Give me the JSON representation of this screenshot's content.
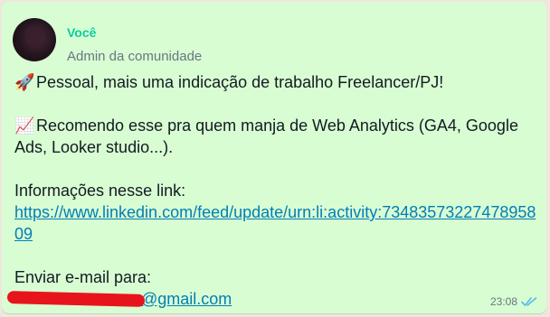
{
  "message": {
    "sender": "Você",
    "role": "Admin da comunidade",
    "line1_emoji": "🚀",
    "line1": "Pessoal, mais uma indicação de trabalho Freelancer/PJ!",
    "line2_emoji": "📈",
    "line2a": "Recomendo esse pra quem manja de Web Analytics (GA4, Google",
    "line2b": "Ads, Looker studio...).",
    "info_label": "Informações nesse link:",
    "link_part1": "https://www.linkedin.com/feed/update/urn:li:activity:73483573227478958",
    "link_part2": "09",
    "email_label": "Enviar e-mail para:",
    "email_visible": "@gmail.com",
    "time": "23:08",
    "status_icon": "double-check-read-icon",
    "accent_color": "#06cf9c",
    "link_color": "#027eb5",
    "bubble_color": "#d9fdd3"
  }
}
